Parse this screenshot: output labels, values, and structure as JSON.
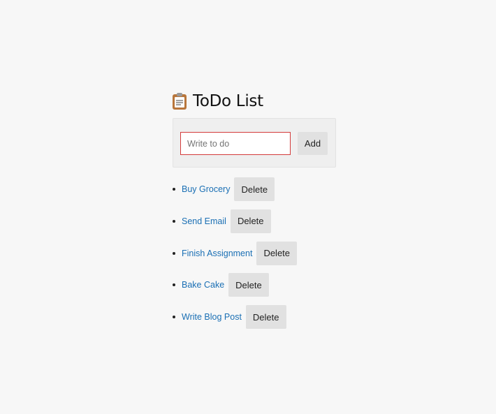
{
  "app": {
    "title": "ToDo List",
    "title_icon": "clipboard-icon"
  },
  "form": {
    "input_value": "",
    "input_placeholder": "Write to do",
    "add_label": "Add"
  },
  "todos": [
    {
      "text": "Buy Grocery",
      "delete_label": "Delete"
    },
    {
      "text": "Send Email",
      "delete_label": "Delete"
    },
    {
      "text": "Finish Assignment",
      "delete_label": "Delete"
    },
    {
      "text": "Bake Cake",
      "delete_label": "Delete"
    },
    {
      "text": "Write Blog Post",
      "delete_label": "Delete"
    }
  ],
  "colors": {
    "background": "#f7f7f7",
    "link": "#1a6fb4",
    "input_border": "#d33a3a",
    "button_bg": "#e1e1e1"
  }
}
